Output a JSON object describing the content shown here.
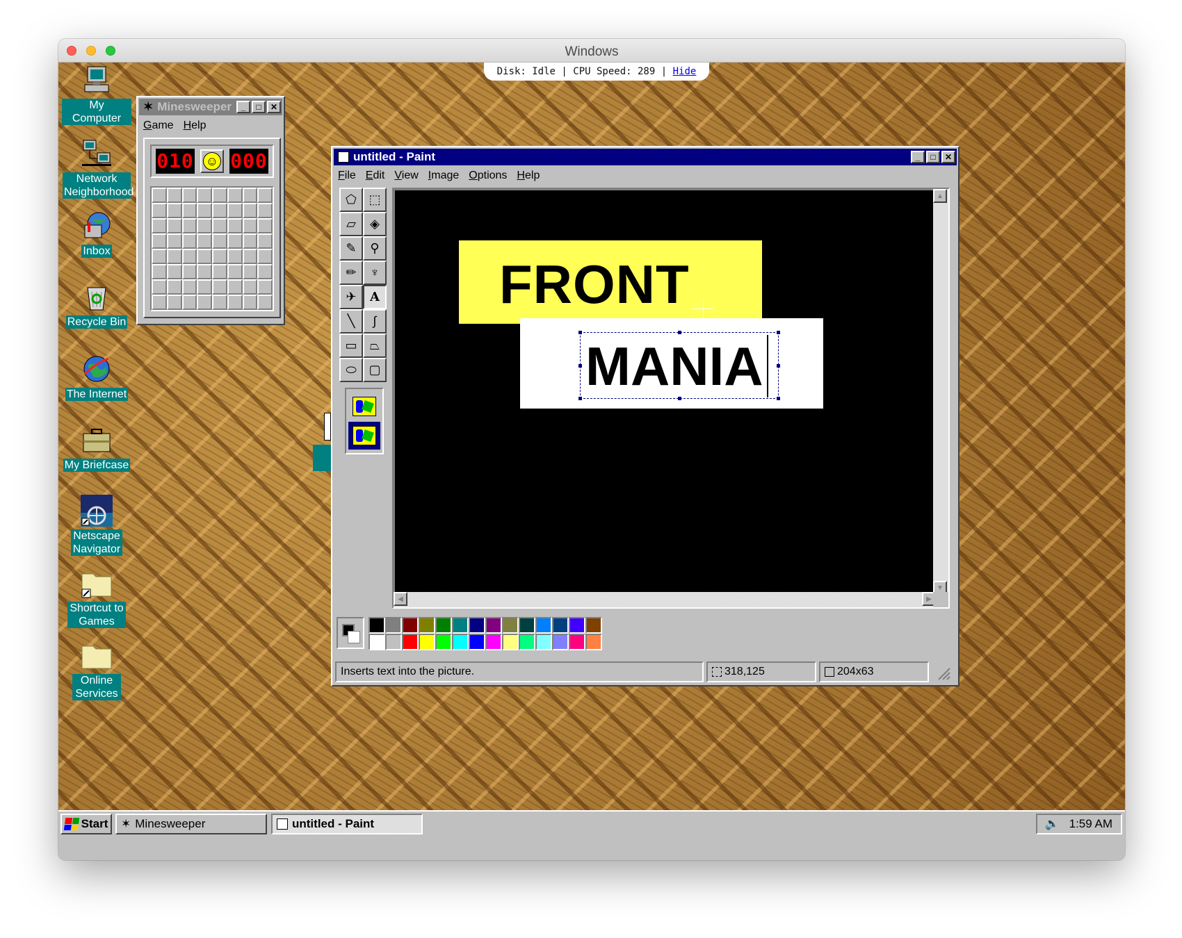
{
  "mac": {
    "title": "Windows"
  },
  "status": {
    "disk": "Disk: Idle",
    "cpu": "CPU Speed: 289",
    "sep": "|",
    "hide": "Hide"
  },
  "desktop_icons": [
    {
      "label": "My Computer",
      "icon": "computer-icon"
    },
    {
      "label": "Network Neighborhood",
      "icon": "network-icon"
    },
    {
      "label": "Inbox",
      "icon": "inbox-icon"
    },
    {
      "label": "Recycle Bin",
      "icon": "recycle-bin-icon"
    },
    {
      "label": "The Internet",
      "icon": "globe-icon"
    },
    {
      "label": "My Briefcase",
      "icon": "briefcase-icon"
    },
    {
      "label": "Netscape Navigator",
      "icon": "netscape-icon"
    },
    {
      "label": "Shortcut to Games",
      "icon": "folder-icon"
    },
    {
      "label": "Online Services",
      "icon": "folder-icon"
    }
  ],
  "minesweeper": {
    "title": "Minesweeper",
    "menu": [
      "Game",
      "Help"
    ],
    "mines_counter": "010",
    "timer": "000",
    "face": "☺",
    "rows": 8,
    "cols": 8
  },
  "paint": {
    "title": "untitled - Paint",
    "menu": [
      "File",
      "Edit",
      "View",
      "Image",
      "Options",
      "Help"
    ],
    "tools": [
      "free-select",
      "rect-select",
      "eraser",
      "fill",
      "color-picker",
      "magnifier",
      "pencil",
      "brush",
      "airbrush",
      "text",
      "line",
      "curve",
      "rectangle",
      "polygon",
      "ellipse",
      "rounded-rect"
    ],
    "selected_tool": "text",
    "canvas_text_1": "FRONT",
    "canvas_text_2": "MANIA",
    "palette_top": [
      "#000000",
      "#808080",
      "#800000",
      "#808000",
      "#008000",
      "#008080",
      "#000080",
      "#800080",
      "#808040",
      "#004040",
      "#0080ff",
      "#004080",
      "#4000ff",
      "#804000"
    ],
    "palette_bottom": [
      "#ffffff",
      "#c0c0c0",
      "#ff0000",
      "#ffff00",
      "#00ff00",
      "#00ffff",
      "#0000ff",
      "#ff00ff",
      "#ffff80",
      "#00ff80",
      "#80ffff",
      "#8080ff",
      "#ff0080",
      "#ff8040"
    ],
    "foreground": "#000000",
    "background": "#ffffff",
    "status_text": "Inserts text into the picture.",
    "coords": "318,125",
    "size": "204x63"
  },
  "taskbar": {
    "start": "Start",
    "tasks": [
      {
        "label": "Minesweeper",
        "active": false
      },
      {
        "label": "untitled - Paint",
        "active": true
      }
    ],
    "time": "1:59 AM"
  }
}
